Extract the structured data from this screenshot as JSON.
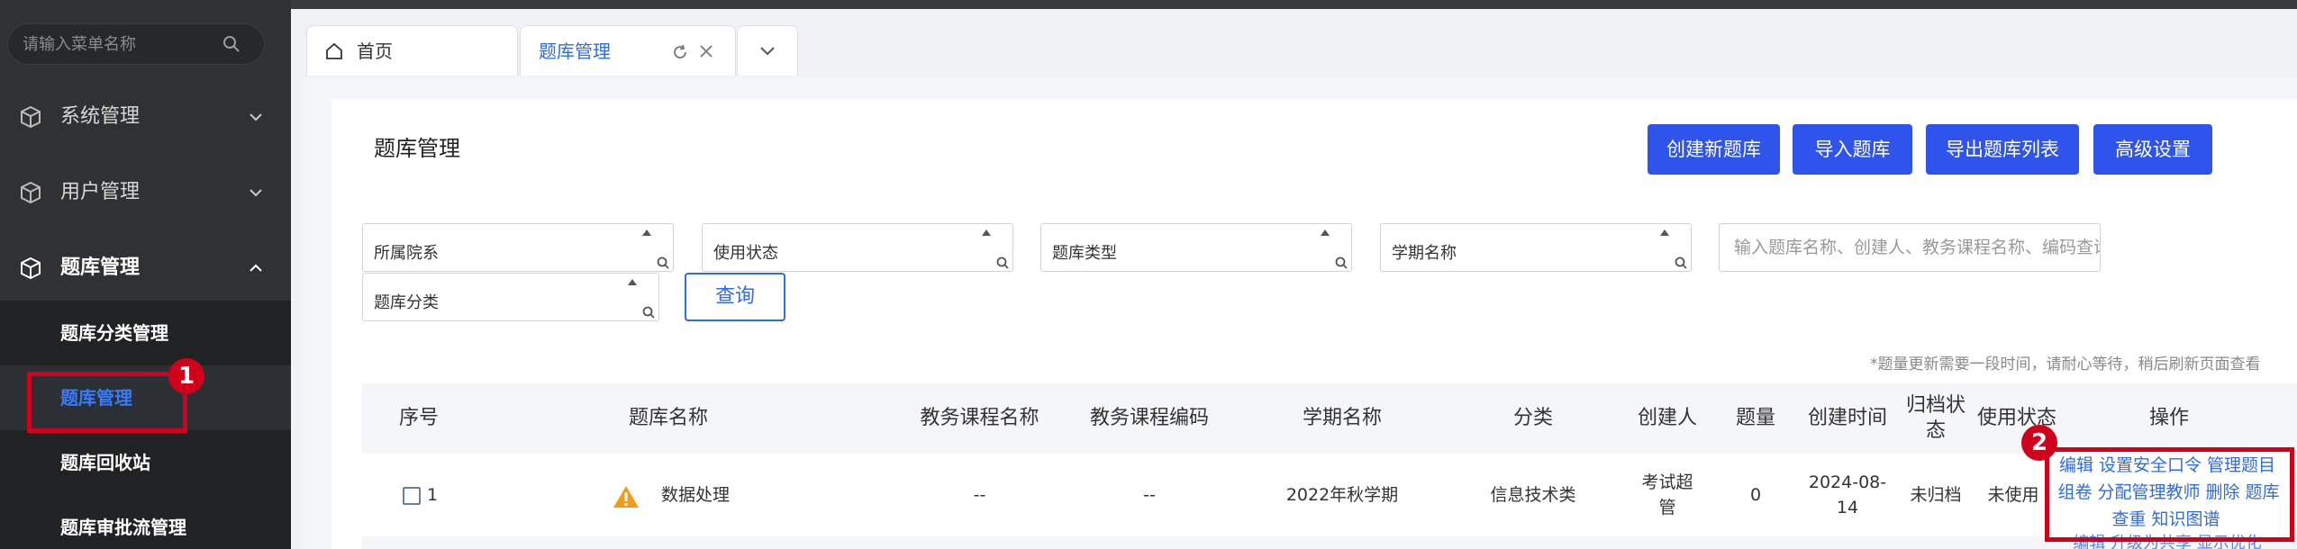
{
  "sidebar": {
    "search_placeholder": "请输入菜单名称",
    "menu": [
      {
        "label": "系统管理"
      },
      {
        "label": "用户管理"
      },
      {
        "label": "题库管理"
      }
    ],
    "submenu": [
      {
        "label": "题库分类管理"
      },
      {
        "label": "题库管理"
      },
      {
        "label": "题库回收站"
      },
      {
        "label": "题库审批流管理"
      }
    ]
  },
  "tabs": {
    "home": "首页",
    "active": "题库管理"
  },
  "page": {
    "title": "题库管理",
    "buttons": [
      "创建新题库",
      "导入题库",
      "导出题库列表",
      "高级设置"
    ],
    "filters": [
      "所属院系",
      "使用状态",
      "题库类型",
      "学期名称",
      "题库分类"
    ],
    "search_placeholder": "输入题库名称、创建人、教务课程名称、编码查询",
    "query_button": "查询",
    "notice": "*题量更新需要一段时间，请耐心等待，稍后刷新页面查看"
  },
  "table": {
    "headers": [
      "序号",
      "题库名称",
      "教务课程名称",
      "教务课程编码",
      "学期名称",
      "分类",
      "创建人",
      "题量",
      "创建时间",
      "归档状态",
      "使用状态",
      "操作"
    ],
    "rows": [
      {
        "index": "1",
        "name": "数据处理",
        "course_name": "--",
        "course_code": "--",
        "semester": "2022年秋学期",
        "category": "信息技术类",
        "creator": "考试超管",
        "count": "0",
        "created": "2024-08-14",
        "archive": "未归档",
        "usage": "未使用",
        "ops": [
          "编辑",
          "设置安全口令",
          "管理题目",
          "组卷",
          "分配管理教师",
          "删除",
          "题库查重",
          "知识图谱"
        ],
        "ops_overflow": "编辑  升级为共享  显示优化"
      }
    ]
  },
  "annotations": {
    "badge1": "1",
    "badge2": "2"
  },
  "colors": {
    "accent": "#2f54eb",
    "link": "#2f6bea",
    "annotation": "#d0021b",
    "sidebar_bg": "#2f3133"
  }
}
